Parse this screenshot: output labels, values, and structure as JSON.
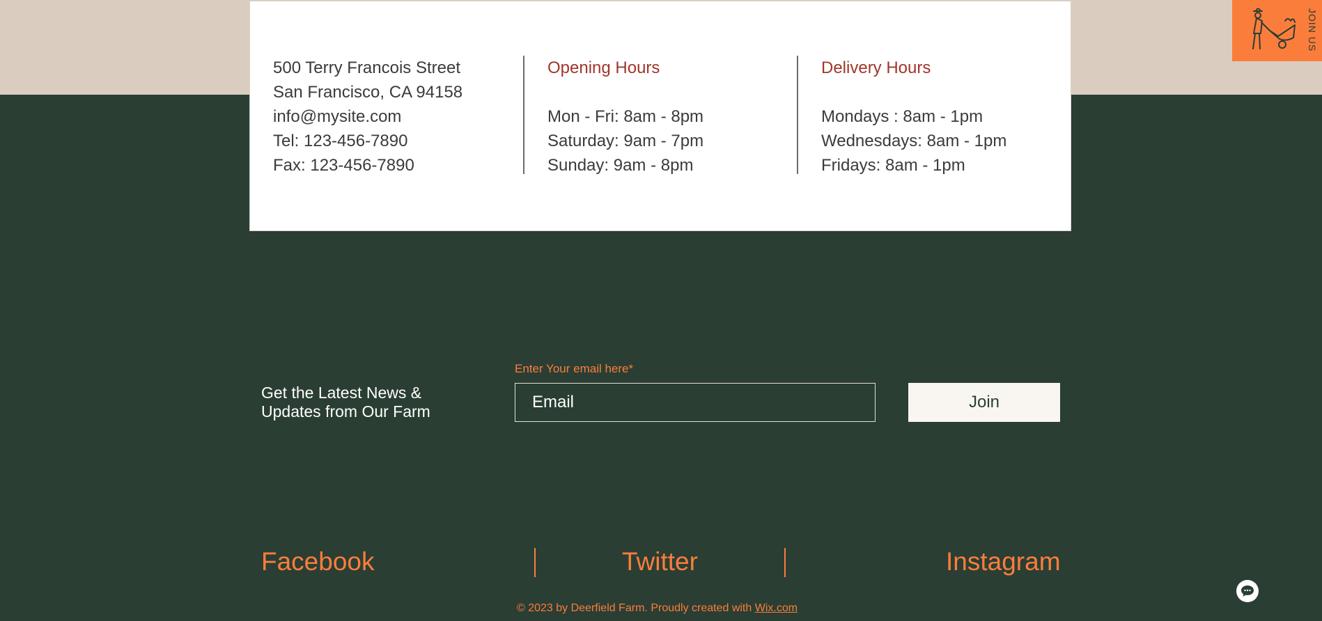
{
  "contact": {
    "address_line1": "500 Terry Francois Street",
    "address_line2": "San Francisco, CA 94158",
    "email": "info@mysite.com",
    "tel": "Tel: 123-456-7890",
    "fax": "Fax: 123-456-7890"
  },
  "opening_hours": {
    "heading": "Opening Hours",
    "items": [
      "Mon - Fri: 8am - 8pm",
      "Saturday: 9am - 7pm",
      "Sunday: 9am - 8pm"
    ]
  },
  "delivery_hours": {
    "heading": "Delivery Hours",
    "items": [
      "Mondays : 8am - 1pm",
      "Wednesdays: 8am - 1pm",
      "Fridays: 8am - 1pm"
    ]
  },
  "join_us": {
    "label": "JOIN US",
    "icon": "farmer-wheelbarrow-icon"
  },
  "newsletter": {
    "title_line1": "Get the Latest News &",
    "title_line2": "Updates from Our Farm",
    "email_label": "Enter Your email here*",
    "email_placeholder": "Email",
    "email_value": "",
    "join_label": "Join"
  },
  "social": {
    "facebook": "Facebook",
    "twitter": "Twitter",
    "instagram": "Instagram"
  },
  "footer": {
    "copyright": "© 2023 by Deerfield Farm. Proudly created with ",
    "link_text": "Wix.com"
  },
  "chat": {
    "icon": "chat-bubble-icon"
  },
  "colors": {
    "dark_green": "#2a3e33",
    "beige": "#dacdc0",
    "orange": "#fb7d3c",
    "heading_red": "#a0362b",
    "off_white": "#f9f6f1"
  }
}
